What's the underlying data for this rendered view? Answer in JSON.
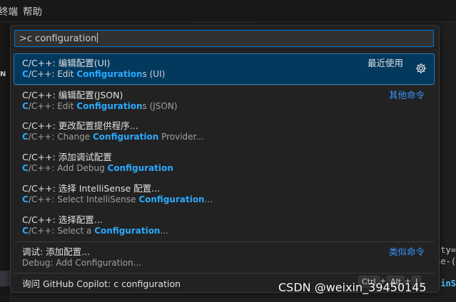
{
  "menubar": {
    "items": [
      "终端",
      "帮助"
    ]
  },
  "background": {
    "left_letter": "N",
    "right_lines": [
      "tty=",
      "ne-(",
      "inS"
    ]
  },
  "palette": {
    "input": {
      "value": ">c configuration"
    },
    "items": [
      {
        "title_pre": "C/C++: 编辑配置(UI)",
        "desc_parts": [
          "C",
          "/C++: Edit ",
          "Configuration",
          "s (UI)"
        ],
        "tag": "最近使用",
        "has_gear": true,
        "selected": true
      },
      {
        "title_pre": "C/C++: 编辑配置(JSON)",
        "desc_parts": [
          "C",
          "/C++: Edit ",
          "Configuration",
          "s (JSON)"
        ],
        "tag": "其他命令"
      },
      {
        "title_pre": "C/C++: 更改配置提供程序...",
        "desc_parts": [
          "C",
          "/C++: Change ",
          "Configuration",
          " Provider..."
        ]
      },
      {
        "title_pre": "C/C++: 添加调试配置",
        "desc_parts": [
          "C",
          "/C++: Add Debug ",
          "Configuration",
          ""
        ]
      },
      {
        "title_pre": "C/C++: 选择 IntelliSense 配置...",
        "desc_parts": [
          "C",
          "/C++: Select IntelliSense ",
          "Configuration",
          "..."
        ]
      },
      {
        "title_pre": "C/C++: 选择配置...",
        "desc_parts": [
          "C",
          "/C++: Select a ",
          "Configuration",
          "..."
        ]
      },
      {
        "title_pre": "调试: 添加配置...",
        "desc_parts": [
          "",
          "Debug: Add Configuration...",
          "",
          ""
        ],
        "tag": "类似命令"
      }
    ],
    "copilot": {
      "label": "询问 GitHub Copilot: c configuration",
      "keys": [
        "Ctrl",
        "Alt",
        "I"
      ]
    }
  },
  "watermark": "CSDN @weixin_39450145",
  "colors": {
    "accent": "#0078d4",
    "highlight": "#2aaaff",
    "selected_bg": "#04395e",
    "tag_blue": "#3794ff"
  }
}
